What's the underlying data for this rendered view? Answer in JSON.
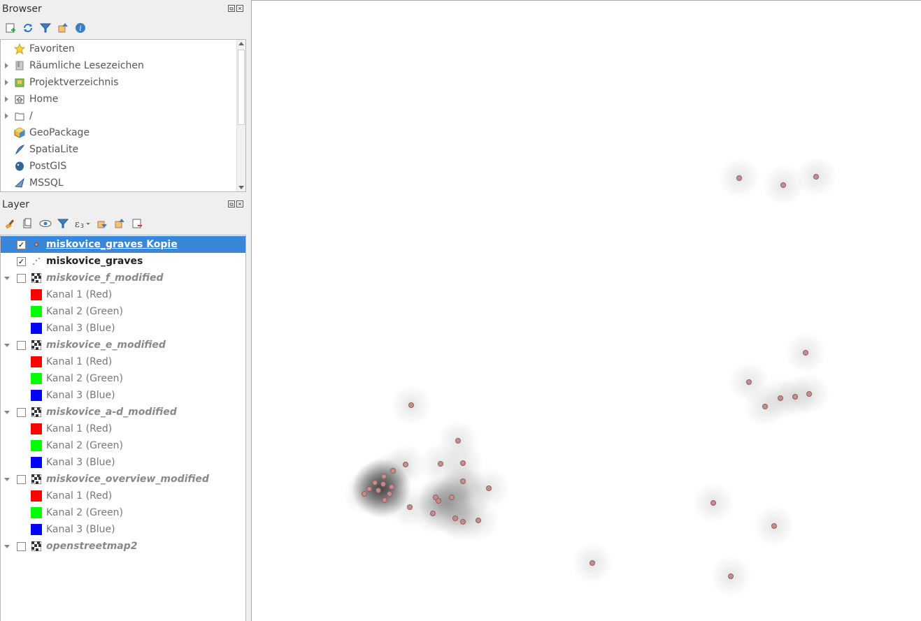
{
  "browser": {
    "title": "Browser",
    "toolbar": [
      "add-layer-icon",
      "refresh-icon",
      "filter-icon",
      "collapse-all-icon",
      "info-icon"
    ],
    "items": [
      {
        "label": "Favoriten",
        "icon": "star-icon",
        "expandable": false
      },
      {
        "label": "Räumliche Lesezeichen",
        "icon": "bookmark-icon",
        "expandable": true
      },
      {
        "label": "Projektverzeichnis",
        "icon": "project-folder-icon",
        "expandable": true
      },
      {
        "label": "Home",
        "icon": "home-folder-icon",
        "expandable": true
      },
      {
        "label": "/",
        "icon": "folder-icon",
        "expandable": true
      },
      {
        "label": "GeoPackage",
        "icon": "geopackage-icon",
        "expandable": false
      },
      {
        "label": "SpatiaLite",
        "icon": "spatialite-icon",
        "expandable": false
      },
      {
        "label": "PostGIS",
        "icon": "postgis-icon",
        "expandable": false
      },
      {
        "label": "MSSQL",
        "icon": "mssql-icon",
        "expandable": false
      }
    ]
  },
  "layers": {
    "title": "Layer",
    "toolbar": [
      "style-brush-icon",
      "add-group-icon",
      "visibility-eye-icon",
      "filter-legend-icon",
      "expression-filter-icon",
      "expand-all-icon",
      "collapse-all-icon",
      "remove-layer-icon"
    ],
    "items": [
      {
        "type": "layer",
        "label": "miskovice_graves Kopie",
        "checked": true,
        "kind": "point",
        "active": true,
        "selected": true
      },
      {
        "type": "layer",
        "label": "miskovice_graves",
        "checked": true,
        "kind": "point-scatter",
        "active": true,
        "selected": false
      },
      {
        "type": "layer",
        "label": "miskovice_f_modified",
        "checked": false,
        "kind": "raster",
        "active": false,
        "expandable": true
      },
      {
        "type": "band",
        "label": "Kanal 1 (Red)",
        "color": "#ff0000"
      },
      {
        "type": "band",
        "label": "Kanal 2 (Green)",
        "color": "#00ff00"
      },
      {
        "type": "band",
        "label": "Kanal 3 (Blue)",
        "color": "#0000ff"
      },
      {
        "type": "layer",
        "label": "miskovice_e_modified",
        "checked": false,
        "kind": "raster",
        "active": false,
        "expandable": true
      },
      {
        "type": "band",
        "label": "Kanal 1 (Red)",
        "color": "#ff0000"
      },
      {
        "type": "band",
        "label": "Kanal 2 (Green)",
        "color": "#00ff00"
      },
      {
        "type": "band",
        "label": "Kanal 3 (Blue)",
        "color": "#0000ff"
      },
      {
        "type": "layer",
        "label": "miskovice_a-d_modified",
        "checked": false,
        "kind": "raster",
        "active": false,
        "expandable": true
      },
      {
        "type": "band",
        "label": "Kanal 1 (Red)",
        "color": "#ff0000"
      },
      {
        "type": "band",
        "label": "Kanal 2 (Green)",
        "color": "#00ff00"
      },
      {
        "type": "band",
        "label": "Kanal 3 (Blue)",
        "color": "#0000ff"
      },
      {
        "type": "layer",
        "label": "miskovice_overview_modified",
        "checked": false,
        "kind": "raster",
        "active": false,
        "expandable": true
      },
      {
        "type": "band",
        "label": "Kanal 1 (Red)",
        "color": "#ff0000"
      },
      {
        "type": "band",
        "label": "Kanal 2 (Green)",
        "color": "#00ff00"
      },
      {
        "type": "band",
        "label": "Kanal 3 (Blue)",
        "color": "#0000ff"
      },
      {
        "type": "layer",
        "label": "openstreetmap2",
        "checked": false,
        "kind": "raster",
        "active": false,
        "expandable": true
      }
    ]
  },
  "map": {
    "point_color": "#c98c8c",
    "point_stroke": "#8a6060",
    "heat_color": "#000000"
  }
}
